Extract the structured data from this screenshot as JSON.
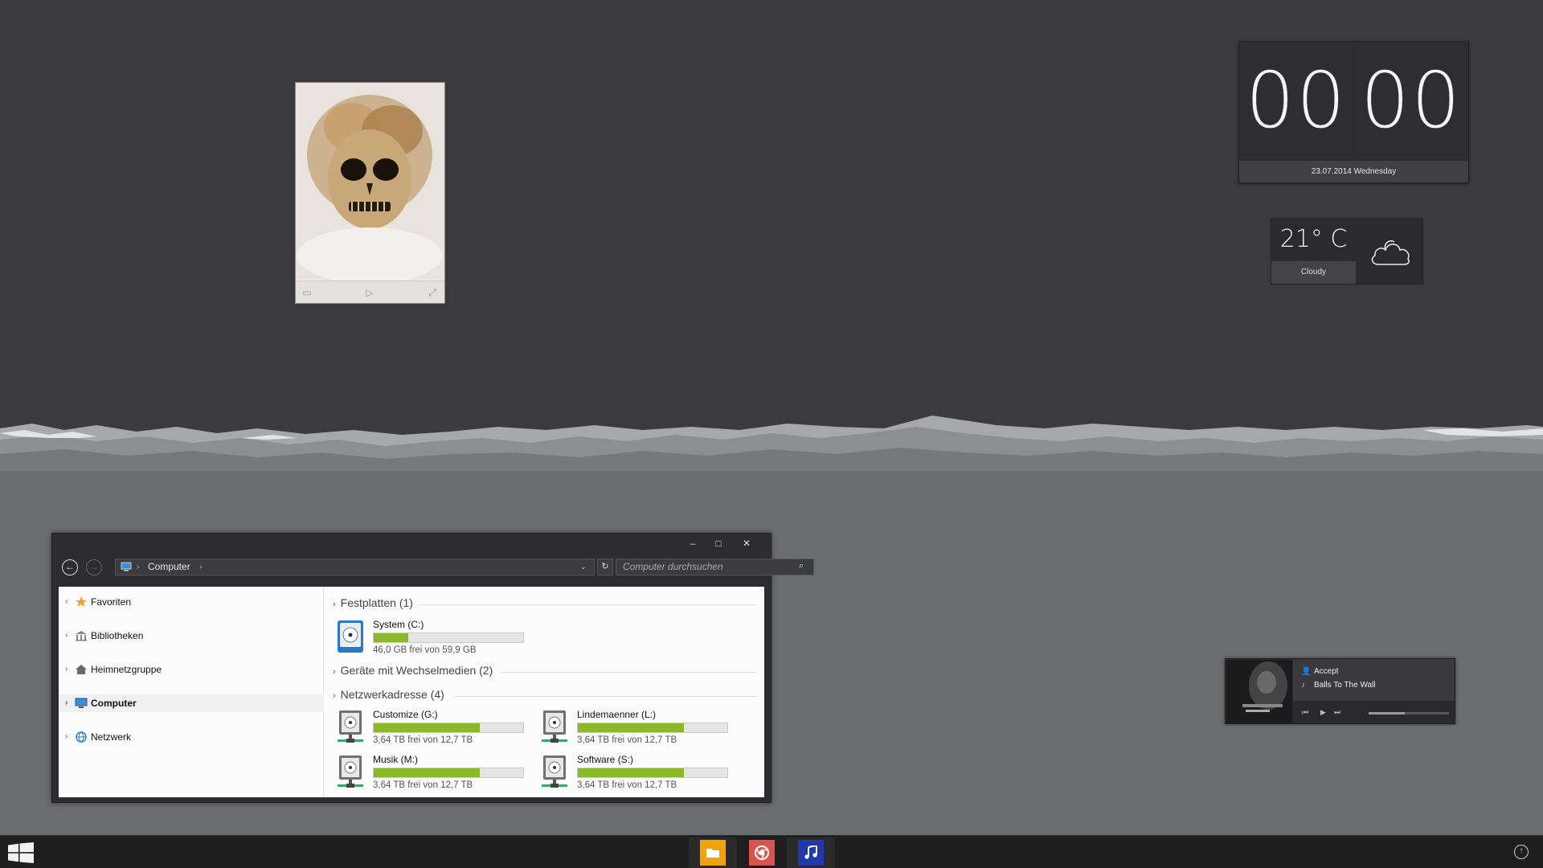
{
  "desktop": {
    "colors": {
      "sky": "#3b3b3d",
      "ground": "#6b6c6f",
      "mountains": "#8f9092"
    }
  },
  "photo_gadget": {
    "icons": [
      "slideshow-icon",
      "play-icon",
      "expand-icon"
    ]
  },
  "clock": {
    "hours": "00",
    "minutes": "00",
    "date": "23.07.2014 Wednesday"
  },
  "weather": {
    "temperature": "21° C",
    "condition": "Cloudy",
    "icon": "cloud-icon"
  },
  "explorer": {
    "window_controls": {
      "minimize": "–",
      "maximize": "□",
      "close": "✕"
    },
    "back": "←",
    "forward": "→",
    "breadcrumb": [
      "Computer"
    ],
    "search_placeholder": "Computer durchsuchen",
    "nav": [
      {
        "label": "Favoriten",
        "icon": "star-icon"
      },
      {
        "label": "Bibliotheken",
        "icon": "library-icon"
      },
      {
        "label": "Heimnetzgruppe",
        "icon": "homegroup-icon"
      },
      {
        "label": "Computer",
        "icon": "computer-icon",
        "selected": true
      },
      {
        "label": "Netzwerk",
        "icon": "network-icon"
      }
    ],
    "groups": {
      "hard_disks": "Festplatten (1)",
      "removable": "Geräte mit Wechselmedien (2)",
      "network": "Netzwerkadresse (4)"
    },
    "drives": [
      {
        "name": "System (C:)",
        "free": "46,0 GB frei von 59,9 GB",
        "used_fraction": 0.23,
        "type": "hdd"
      },
      {
        "name": "Customize (G:)",
        "free": "3,64 TB frei von 12,7 TB",
        "used_fraction": 0.71,
        "type": "network"
      },
      {
        "name": "Lindemaenner (L:)",
        "free": "3,64 TB frei von 12,7 TB",
        "used_fraction": 0.71,
        "type": "network"
      },
      {
        "name": "Musik (M:)",
        "free": "3,64 TB frei von 12,7 TB",
        "used_fraction": 0.71,
        "type": "network"
      },
      {
        "name": "Software (S:)",
        "free": "3,64 TB frei von 12,7 TB",
        "used_fraction": 0.71,
        "type": "network"
      }
    ],
    "accent": "#8cb82c"
  },
  "player": {
    "artist": "Accept",
    "track": "Balls To The Wall",
    "progress": 0.45
  },
  "taskbar": {
    "apps": [
      {
        "name": "file-explorer",
        "color": "#f0a30a"
      },
      {
        "name": "chrome",
        "color": "#d9534f"
      },
      {
        "name": "music",
        "color": "#1f3aa8"
      }
    ]
  }
}
